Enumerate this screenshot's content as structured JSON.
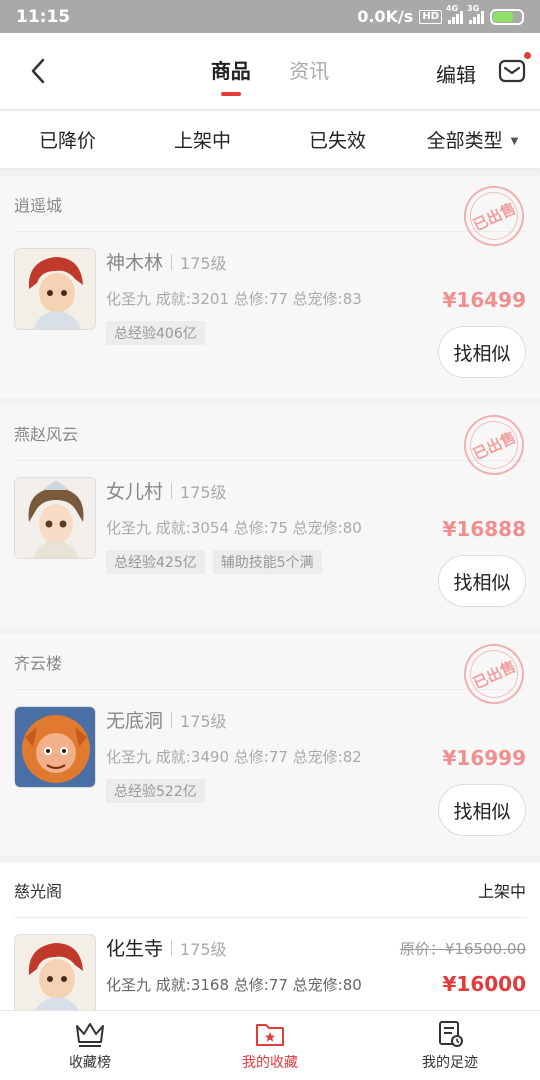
{
  "status_bar": {
    "time": "11:15",
    "speed": "0.0K/s",
    "hd": "HD",
    "net1": "4G",
    "net2": "3G"
  },
  "header": {
    "tabs": [
      {
        "label": "商品",
        "active": true
      },
      {
        "label": "资讯",
        "active": false
      }
    ],
    "edit_label": "编辑",
    "back_icon": "chevron-left-icon",
    "mail_icon": "mail-icon"
  },
  "filters": [
    "已降价",
    "上架中",
    "已失效",
    "全部类型"
  ],
  "colors": {
    "accent": "#e23b3b",
    "faded_price": "#f08f8f",
    "stamp": "#f1a0a0"
  },
  "cards": [
    {
      "server": "逍遥城",
      "stamp": "已出售",
      "name": "神木林",
      "level": "175级",
      "stats": "化圣九 成就:3201 总修:77 总宠修:83",
      "tags": [
        "总经验406亿"
      ],
      "price": "¥16499",
      "similar_label": "找相似"
    },
    {
      "server": "燕赵风云",
      "stamp": "已出售",
      "name": "女儿村",
      "level": "175级",
      "stats": "化圣九 成就:3054 总修:75 总宠修:80",
      "tags": [
        "总经验425亿",
        "辅助技能5个满"
      ],
      "price": "¥16888",
      "similar_label": "找相似"
    },
    {
      "server": "齐云楼",
      "stamp": "已出售",
      "name": "无底洞",
      "level": "175级",
      "stats": "化圣九 成就:3490 总修:77 总宠修:82",
      "tags": [
        "总经验522亿"
      ],
      "price": "¥16999",
      "similar_label": "找相似"
    },
    {
      "server": "慈光阁",
      "status": "上架中",
      "name": "化生寺",
      "level": "175级",
      "stats": "化圣九 成就:3168 总修:77 总宠修:80",
      "original_price": "原价：¥16500.00",
      "price": "¥16000"
    }
  ],
  "bottom_nav": [
    {
      "label": "收藏榜",
      "icon": "crown-icon",
      "active": false
    },
    {
      "label": "我的收藏",
      "icon": "favorites-folder-icon",
      "active": true
    },
    {
      "label": "我的足迹",
      "icon": "history-icon",
      "active": false
    }
  ]
}
